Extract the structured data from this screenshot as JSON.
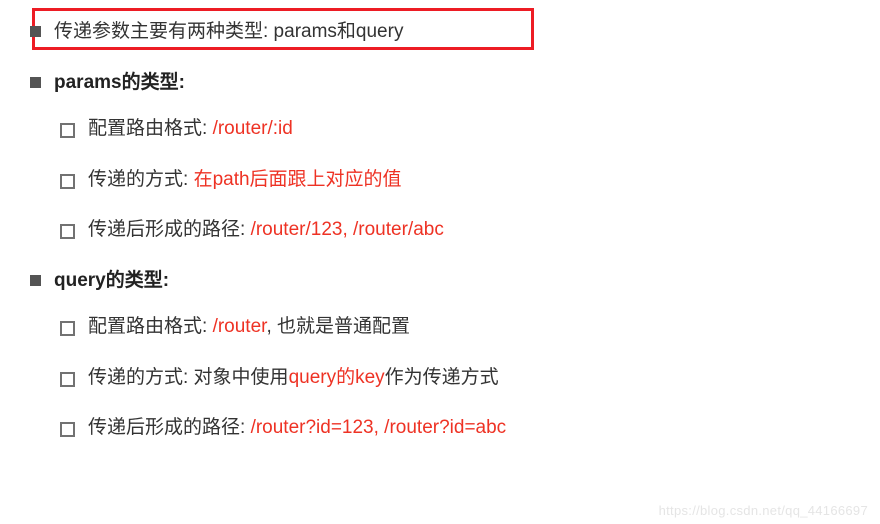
{
  "line1": "传递参数主要有两种类型: params和query",
  "section1": {
    "title": "params的类型:",
    "items": [
      {
        "label": "配置路由格式: ",
        "value": "/router/:id"
      },
      {
        "label": "传递的方式: ",
        "value": "在path后面跟上对应的值"
      },
      {
        "label": "传递后形成的路径: ",
        "value": "/router/123, /router/abc"
      }
    ]
  },
  "section2": {
    "title": "query的类型:",
    "items": [
      {
        "label": "配置路由格式: ",
        "value_red": "/router",
        "value_tail": ", 也就是普通配置"
      },
      {
        "label": "传递的方式: 对象中使用",
        "value_red": "query的key",
        "value_tail": "作为传递方式"
      },
      {
        "label": "传递后形成的路径: ",
        "value_red": "/router?id=123, /router?id=abc",
        "value_tail": ""
      }
    ]
  },
  "watermark": "https://blog.csdn.net/qq_44166697"
}
